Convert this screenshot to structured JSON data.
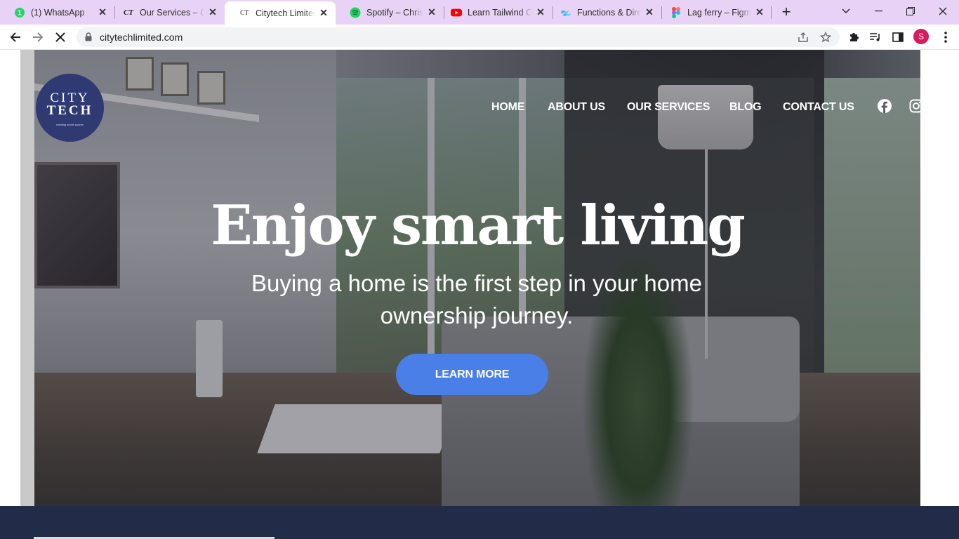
{
  "tabs": [
    {
      "title": "(1) WhatsApp",
      "icon": "whatsapp-icon"
    },
    {
      "title": "Our Services – Citytech",
      "icon": "ct-icon"
    },
    {
      "title": "Citytech Limited",
      "icon": "ct-icon"
    },
    {
      "title": "Spotify – Christian",
      "icon": "spotify-icon"
    },
    {
      "title": "Learn Tailwind CSS",
      "icon": "youtube-icon"
    },
    {
      "title": "Functions & Directives",
      "icon": "tailwind-icon"
    },
    {
      "title": "Lag ferry – Figma",
      "icon": "figma-icon"
    }
  ],
  "tab_badge": "1",
  "ct_favicon_text": "CT",
  "address_bar": {
    "url": "citytechlimited.com"
  },
  "profile_initial": "S",
  "site": {
    "logo": {
      "line1": "CITY",
      "line2": "TECH",
      "tagline": "creating smart spaces"
    },
    "nav": [
      "HOME",
      "ABOUT US",
      "OUR SERVICES",
      "BLOG",
      "CONTACT US"
    ],
    "headline": "Enjoy smart living",
    "subheadline": "Buying a home is the first step in your home ownership journey.",
    "cta_label": "LEARN MORE"
  },
  "colors": {
    "tab_strip": "#e8d3f6",
    "cta": "#4a7fe8",
    "logo_bg": "#2f3a73",
    "footer": "#222b48",
    "profile": "#d81b60"
  }
}
